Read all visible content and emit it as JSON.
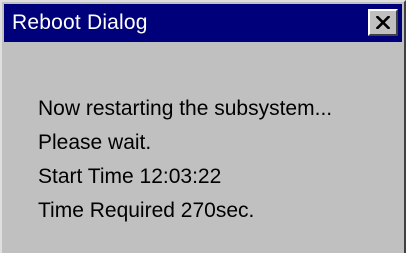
{
  "window": {
    "title": "Reboot Dialog",
    "close_icon": "close-icon"
  },
  "message": {
    "line1": "Now restarting the subsystem...",
    "line2": "Please wait.",
    "line3": "Start Time 12:03:22",
    "line4": "Time Required 270sec."
  },
  "colors": {
    "titlebar": "#00007b",
    "background": "#c0c0c0",
    "text": "#000000",
    "title_text": "#ffffff"
  }
}
